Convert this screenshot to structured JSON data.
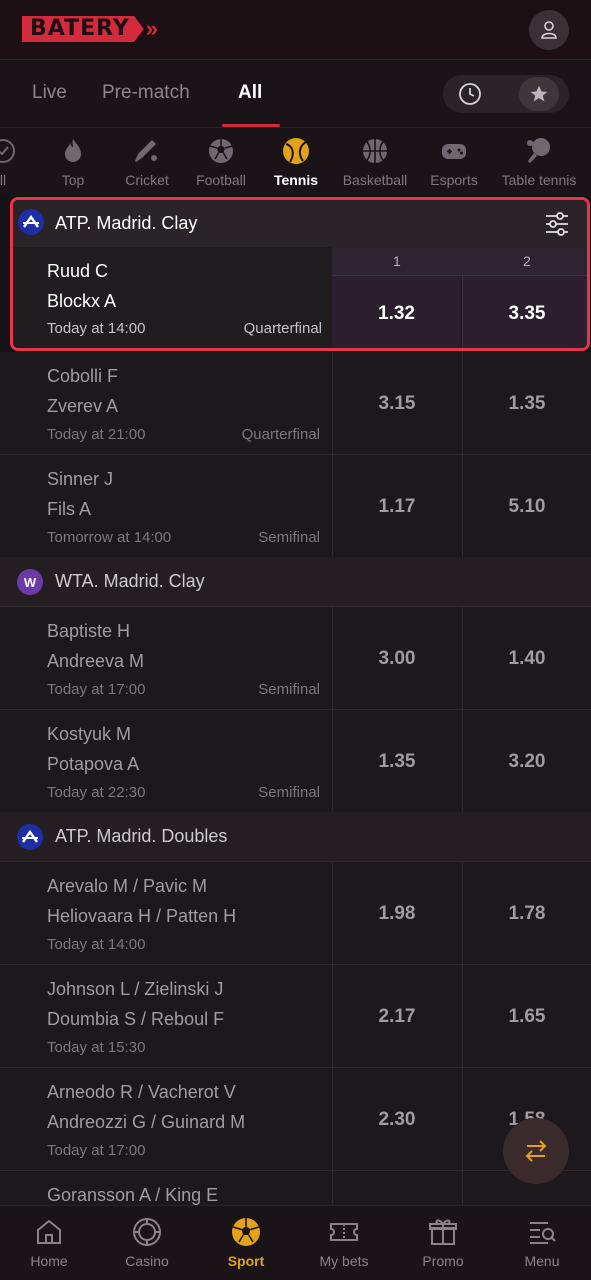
{
  "brand": {
    "name": "BATERY",
    "chevron": "»"
  },
  "header": {
    "user_icon": "user-icon"
  },
  "tabs": [
    {
      "label": "Live"
    },
    {
      "label": "Pre-match"
    },
    {
      "label": "All"
    }
  ],
  "sports": [
    {
      "label": "ll",
      "icon": "check-circle-icon"
    },
    {
      "label": "Top",
      "icon": "fire-icon"
    },
    {
      "label": "Cricket",
      "icon": "cricket-icon"
    },
    {
      "label": "Football",
      "icon": "football-icon"
    },
    {
      "label": "Tennis",
      "icon": "tennis-icon"
    },
    {
      "label": "Basketball",
      "icon": "basketball-icon"
    },
    {
      "label": "Esports",
      "icon": "gamepad-icon"
    },
    {
      "label": "Table tennis",
      "icon": "table-tennis-icon"
    }
  ],
  "highlight": {
    "league": "ATP. Madrid. Clay",
    "col1": "1",
    "col2": "2",
    "match": {
      "p1": "Ruud C",
      "p2": "Blockx A",
      "time": "Today at 14:00",
      "stage": "Quarterfinal",
      "odd1": "1.32",
      "odd2": "3.35"
    }
  },
  "matches_atp": [
    {
      "p1": "Cobolli F",
      "p2": "Zverev A",
      "time": "Today at 21:00",
      "stage": "Quarterfinal",
      "odd1": "3.15",
      "odd2": "1.35"
    },
    {
      "p1": "Sinner J",
      "p2": "Fils A",
      "time": "Tomorrow at 14:00",
      "stage": "Semifinal",
      "odd1": "1.17",
      "odd2": "5.10"
    }
  ],
  "league_wta": {
    "name": "WTA. Madrid. Clay",
    "icon_letter": "W"
  },
  "matches_wta": [
    {
      "p1": "Baptiste H",
      "p2": "Andreeva M",
      "time": "Today at 17:00",
      "stage": "Semifinal",
      "odd1": "3.00",
      "odd2": "1.40"
    },
    {
      "p1": "Kostyuk M",
      "p2": "Potapova A",
      "time": "Today at 22:30",
      "stage": "Semifinal",
      "odd1": "1.35",
      "odd2": "3.20"
    }
  ],
  "league_doubles": {
    "name": "ATP. Madrid. Doubles",
    "icon_letter": "A"
  },
  "matches_doubles": [
    {
      "p1": "Arevalo M / Pavic M",
      "p2": "Heliovaara H / Patten H",
      "time": "Today at 14:00",
      "stage": "",
      "odd1": "1.98",
      "odd2": "1.78"
    },
    {
      "p1": "Johnson L / Zielinski J",
      "p2": "Doumbia S / Reboul F",
      "time": "Today at 15:30",
      "stage": "",
      "odd1": "2.17",
      "odd2": "1.65"
    },
    {
      "p1": "Arneodo R / Vacherot V",
      "p2": "Andreozzi G / Guinard M",
      "time": "Today at 17:00",
      "stage": "",
      "odd1": "2.30",
      "odd2": "1.58"
    },
    {
      "p1": "Goransson A / King E",
      "p2": "",
      "time": "",
      "stage": "",
      "odd1": "",
      "odd2": ""
    }
  ],
  "bottom_nav": [
    {
      "label": "Home",
      "icon": "home-icon"
    },
    {
      "label": "Casino",
      "icon": "casino-icon"
    },
    {
      "label": "Sport",
      "icon": "sport-ball-icon"
    },
    {
      "label": "My bets",
      "icon": "ticket-icon"
    },
    {
      "label": "Promo",
      "icon": "gift-icon"
    },
    {
      "label": "Menu",
      "icon": "menu-search-icon"
    }
  ],
  "colors": {
    "accent": "#d32a3c",
    "active_sport": "#e2a21a",
    "highlight_border": "#e8354a"
  }
}
